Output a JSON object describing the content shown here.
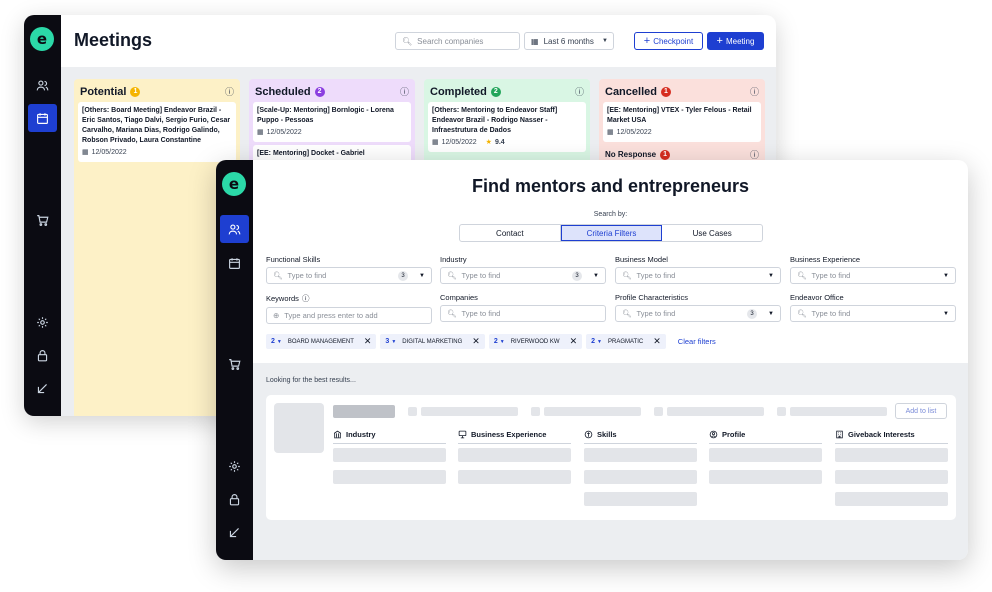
{
  "meetings": {
    "app_logo": "e",
    "title": "Meetings",
    "search_placeholder": "Search companies",
    "period": "Last 6 months",
    "checkpoint_label": "Checkpoint",
    "meeting_label": "Meeting",
    "columns": [
      {
        "name": "Potential",
        "count": "1",
        "bg": "#fdf1c7",
        "head": "#fce8a0",
        "badge": "#f5b400",
        "cards": [
          {
            "text": "[Others: Board Meeting] Endeavor Brazil - Eric Santos, Tiago Dalvi, Sergio Furio, Cesar Carvalho, Mariana Dias, Rodrigo Galindo, Robson Privado, Laura Constantine",
            "date": "12/05/2022"
          }
        ]
      },
      {
        "name": "Scheduled",
        "count": "2",
        "bg": "#eedcfb",
        "head": "#e4c9f9",
        "badge": "#8b3ee0",
        "cards": [
          {
            "text": "[Scale-Up: Mentoring] Bornlogic - Lorena Puppo - Pessoas",
            "date": "12/05/2022"
          },
          {
            "text": "[EE: Mentoring] Docket - Gabriel",
            "date": ""
          }
        ]
      },
      {
        "name": "Completed",
        "count": "2",
        "bg": "#d9f6e4",
        "head": "#c4f0d4",
        "badge": "#22a55a",
        "cards": [
          {
            "text": "[Others: Mentoring to Endeavor Staff] Endeavor Brazil - Rodrigo Nasser - Infraestrutura de Dados",
            "date": "12/05/2022",
            "rating": "9.4"
          }
        ]
      },
      {
        "name": "Cancelled",
        "count": "1",
        "bg": "#fbe0dc",
        "head": "#f8d0ca",
        "badge": "#d62d20",
        "cards": [
          {
            "text": "[EE: Mentoring] VTEX - Tyler Felous - Retail Market USA",
            "date": "12/05/2022"
          }
        ]
      }
    ],
    "no_response": {
      "name": "No Response",
      "count": "1"
    }
  },
  "finder": {
    "app_logo": "e",
    "title": "Find mentors and entrepreneurs",
    "search_by": "Search by:",
    "tabs": [
      "Contact",
      "Criteria Filters",
      "Use Cases"
    ],
    "active_tab": "Criteria Filters",
    "filters": [
      {
        "label": "Functional Skills",
        "placeholder": "Type to find",
        "count": "3"
      },
      {
        "label": "Industry",
        "placeholder": "Type to find",
        "count": "3"
      },
      {
        "label": "Business Model",
        "placeholder": "Type to find",
        "count": ""
      },
      {
        "label": "Business Experience",
        "placeholder": "Type to find",
        "count": ""
      },
      {
        "label": "Keywords",
        "placeholder": "Type and press enter to add",
        "count": ""
      },
      {
        "label": "Companies",
        "placeholder": "Type to find",
        "count": ""
      },
      {
        "label": "Profile Characteristics",
        "placeholder": "Type to find",
        "count": "3"
      },
      {
        "label": "Endeavor Office",
        "placeholder": "Type to find",
        "count": ""
      }
    ],
    "chips": [
      {
        "n": "2",
        "label": "BOARD MANAGEMENT"
      },
      {
        "n": "3",
        "label": "DIGITAL MARKETING"
      },
      {
        "n": "2",
        "label": "RIVERWOOD KW"
      },
      {
        "n": "2",
        "label": "PRAGMATIC"
      }
    ],
    "clear_filters": "Clear filters",
    "looking": "Looking for the best results...",
    "add_to_list": "Add to list",
    "result_columns": [
      "Industry",
      "Business Experience",
      "Skills",
      "Profile",
      "Giveback Interests"
    ]
  },
  "colors": {
    "accent": "#1e3fd1",
    "sidebar": "#0b0b12",
    "logo": "#2bd9a8"
  }
}
